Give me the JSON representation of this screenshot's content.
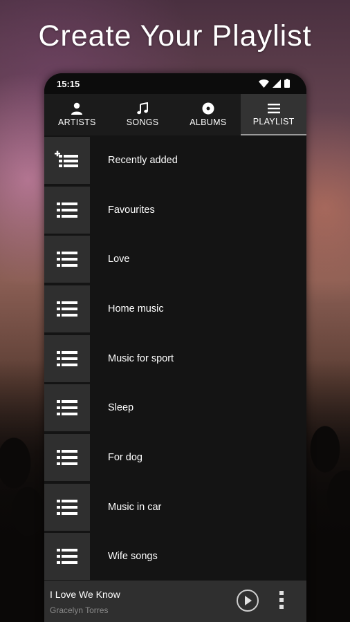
{
  "headline": "Create Your Playlist",
  "status_bar": {
    "time": "15:15"
  },
  "tabs": [
    {
      "label": "ARTISTS",
      "icon": "person-icon"
    },
    {
      "label": "SONGS",
      "icon": "music-note-icon"
    },
    {
      "label": "ALBUMS",
      "icon": "disc-icon"
    },
    {
      "label": "PLAYLIST",
      "icon": "menu-lines-icon",
      "active": true
    }
  ],
  "playlists": [
    {
      "label": "Recently added",
      "icon": "playlist-add-icon"
    },
    {
      "label": "Favourites",
      "icon": "playlist-icon"
    },
    {
      "label": "Love",
      "icon": "playlist-icon"
    },
    {
      "label": "Home music",
      "icon": "playlist-icon"
    },
    {
      "label": "Music for sport",
      "icon": "playlist-icon"
    },
    {
      "label": "Sleep",
      "icon": "playlist-icon"
    },
    {
      "label": "For dog",
      "icon": "playlist-icon"
    },
    {
      "label": "Music in car",
      "icon": "playlist-icon"
    },
    {
      "label": "Wife songs",
      "icon": "playlist-icon"
    }
  ],
  "now_playing": {
    "title": "I Love We Know",
    "artist": "Gracelyn Torres"
  },
  "colors": {
    "panel": "#141414",
    "tab_active": "#333333",
    "thumb": "#2f2f2f",
    "player_bar": "#2f2f2f"
  }
}
